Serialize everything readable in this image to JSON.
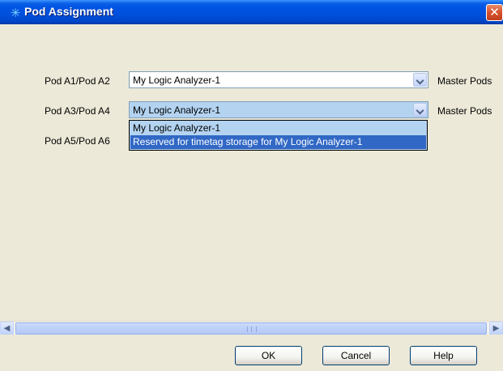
{
  "window": {
    "title": "Pod Assignment",
    "close_glyph": "✕",
    "icon": "sparkle-icon"
  },
  "rows": [
    {
      "label": "Pod A1/Pod A2",
      "value": "My Logic Analyzer-1",
      "status": "Master Pods"
    },
    {
      "label": "Pod A3/Pod A4",
      "value": "My Logic Analyzer-1",
      "status": "Master Pods"
    },
    {
      "label": "Pod A5/Pod A6"
    }
  ],
  "dropdown": {
    "options": [
      "My Logic Analyzer-1",
      "Reserved for timetag storage for My Logic Analyzer-1"
    ],
    "selected_index": 1
  },
  "scrollbar": {
    "left_glyph": "◀",
    "right_glyph": "▶"
  },
  "buttons": {
    "ok": "OK",
    "cancel": "Cancel",
    "help": "Help"
  }
}
